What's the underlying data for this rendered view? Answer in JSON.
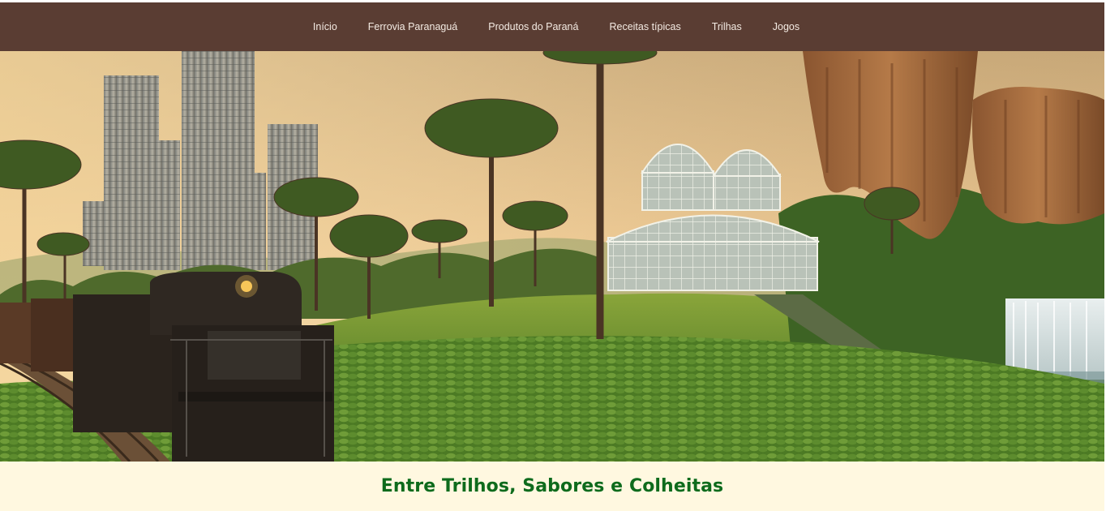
{
  "nav": {
    "items": [
      {
        "label": "Início"
      },
      {
        "label": "Ferrovia Paranaguá"
      },
      {
        "label": "Produtos do Paraná"
      },
      {
        "label": "Receitas típicas"
      },
      {
        "label": "Trilhas"
      },
      {
        "label": "Jogos"
      }
    ]
  },
  "hero": {
    "scene": [
      "city-skyscrapers",
      "araucaria-trees",
      "glass-greenhouse",
      "sandstone-rock-pillars",
      "waterfall",
      "freight-train",
      "crop-field"
    ]
  },
  "banner": {
    "title": "Entre Trilhos, Sabores e Colheitas"
  },
  "colors": {
    "navbar": "#5a3d33",
    "nav_text": "#f4ebe3",
    "banner_bg": "#fff8e0",
    "banner_title": "#0e6b1c"
  }
}
